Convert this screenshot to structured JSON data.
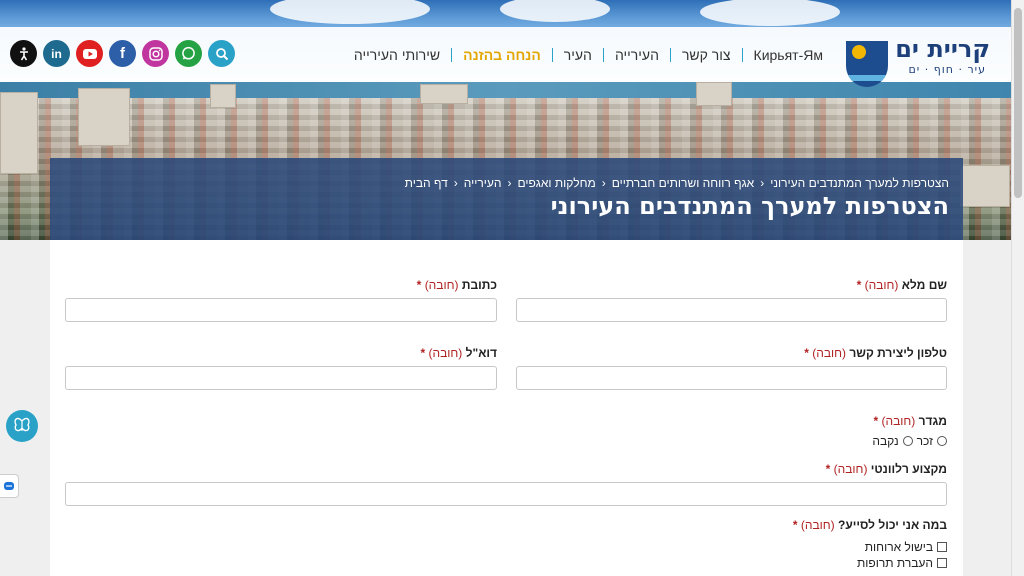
{
  "header": {
    "logo_title": "קריית ים",
    "logo_tagline": "עיר · חוף · ים",
    "nav": [
      {
        "label": "שירותי העירייה",
        "active": false
      },
      {
        "label": "הנחה בהזנה",
        "active": true
      },
      {
        "label": "העיר",
        "active": false
      },
      {
        "label": "העירייה",
        "active": false
      },
      {
        "label": "צור קשר",
        "active": false
      },
      {
        "label": "Кирьят-Ям",
        "active": false
      }
    ],
    "socials": [
      {
        "name": "search-icon",
        "glyph": "⌕",
        "color": "#2aa2c8"
      },
      {
        "name": "whatsapp-icon",
        "glyph": "✆",
        "color": "#25a244"
      },
      {
        "name": "instagram-icon",
        "glyph": "◎",
        "color": "#c1359f"
      },
      {
        "name": "facebook-icon",
        "glyph": "f",
        "color": "#2d5fa8"
      },
      {
        "name": "youtube-icon",
        "glyph": "▶",
        "color": "#e02020"
      },
      {
        "name": "linkedin-icon",
        "glyph": "in",
        "color": "#1f6a8f"
      },
      {
        "name": "accessibility-icon",
        "glyph": "♿",
        "color": "#111111"
      }
    ]
  },
  "breadcrumbs": [
    "דף הבית",
    "העירייה",
    "מחלקות ואגפים",
    "אגף רווחה ושרותים חברתיים",
    "הצטרפות למערך המתנדבים העירוני"
  ],
  "page_title": "הצטרפות למערך המתנדבים העירוני",
  "form": {
    "required_text": "(חובה)",
    "star": "*",
    "full_name_label": "שם מלא",
    "address_label": "כתובת",
    "phone_label": "טלפון ליצירת קשר",
    "email_label": "דוא\"ל",
    "gender_label": "מגדר",
    "gender_options": [
      "זכר",
      "נקבה"
    ],
    "profession_label": "מקצוע רלוונטי",
    "help_label": "במה אני יכול לסייע?",
    "help_options": [
      "בישול ארוחות",
      "העברת תרופות"
    ]
  },
  "colors": {
    "accent": "#2aa2c8",
    "active_nav": "#e3a600",
    "title_box": "#2c4a7c",
    "required": "#b12222"
  }
}
